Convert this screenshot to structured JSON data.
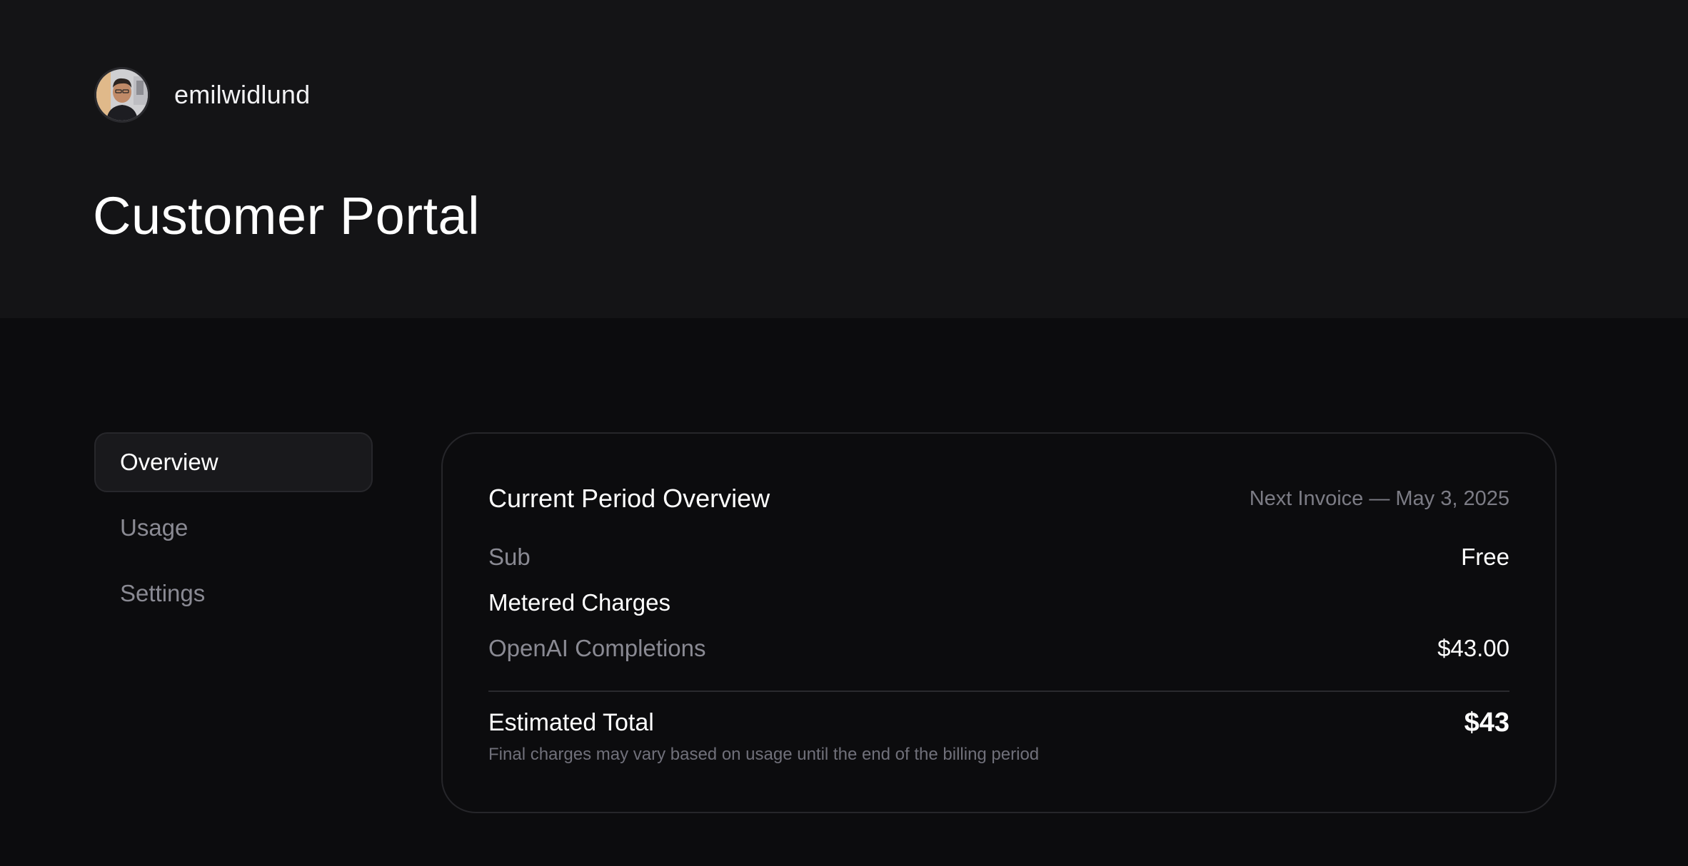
{
  "user": {
    "username": "emilwidlund"
  },
  "page": {
    "title": "Customer Portal"
  },
  "sidebar": {
    "items": [
      {
        "label": "Overview",
        "active": true
      },
      {
        "label": "Usage",
        "active": false
      },
      {
        "label": "Settings",
        "active": false
      }
    ]
  },
  "overview": {
    "title": "Current Period Overview",
    "next_invoice": "Next Invoice — May 3, 2025",
    "subscription": {
      "label": "Sub",
      "value": "Free"
    },
    "metered_label": "Metered Charges",
    "metered_items": [
      {
        "label": "OpenAI Completions",
        "value": "$43.00"
      }
    ],
    "total": {
      "label": "Estimated Total",
      "value": "$43",
      "note": "Final charges may vary based on usage until the end of the billing period"
    }
  },
  "colors": {
    "header_bg": "#141416",
    "page_bg": "#0c0c0e",
    "text_primary": "#ffffff",
    "text_muted": "#8a8a93",
    "border": "#26262a"
  }
}
